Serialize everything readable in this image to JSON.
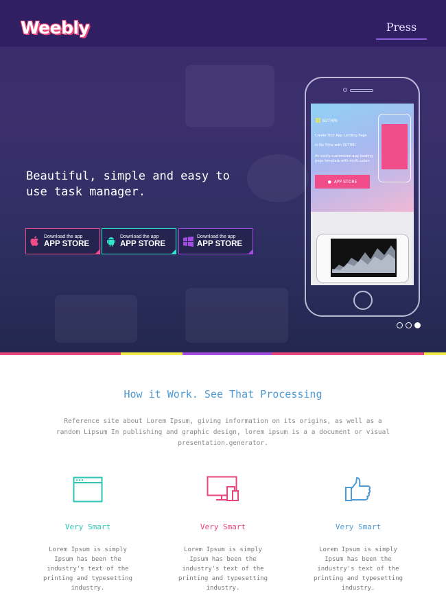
{
  "header": {
    "logo": "Weebly",
    "nav_press": "Press"
  },
  "hero": {
    "headline": "Beautiful, simple and easy to use task manager.",
    "buttons": [
      {
        "small": "Download the app",
        "big": "APP STORE",
        "icon": "apple-icon",
        "color": "#f04d8a"
      },
      {
        "small": "Download the app",
        "big": "APP STORE",
        "icon": "android-icon",
        "color": "#2ee6c9"
      },
      {
        "small": "Download the app",
        "big": "APP STORE",
        "icon": "windows-icon",
        "color": "#a24de0"
      }
    ],
    "phone_screen": {
      "brand": "SUTHRI",
      "line1": "Create Your App Landing Page",
      "line2": "in No Time with SUTHRI",
      "line3": "An easily customized app landing page template with multi colors",
      "button": "APP STORE"
    },
    "carousel": {
      "count": 3,
      "active": 3
    }
  },
  "colors": {
    "stripe": [
      "#e8457a",
      "#f1e84a",
      "#a24de0",
      "#e8457a",
      "#f1e84a"
    ],
    "accent_blue": "#4c9ad6",
    "accent_pink": "#e8457a"
  },
  "section": {
    "title": "How it Work. See That Processing",
    "description": "Reference site about Lorem Ipsum, giving information on its origins, as well as a random Lipsum In publishing and graphic design, lorem ipsum is a a document or visual presentation.generator.",
    "features": [
      {
        "title": "Very Smart",
        "text": "Lorem Ipsum is simply Ipsum has been the industry's text of the printing and typesetting industry.",
        "icon": "browser-window-icon",
        "color": "#2ec4b6"
      },
      {
        "title": "Very Smart",
        "text": "Lorem Ipsum is simply Ipsum has been the industry's text of the printing and typesetting industry.",
        "icon": "devices-icon",
        "color": "#e8457a"
      },
      {
        "title": "Very Smart",
        "text": "Lorem Ipsum is simply Ipsum has been the industry's text of the printing and typesetting industry.",
        "icon": "thumbs-up-icon",
        "color": "#4c9ad6"
      }
    ]
  }
}
